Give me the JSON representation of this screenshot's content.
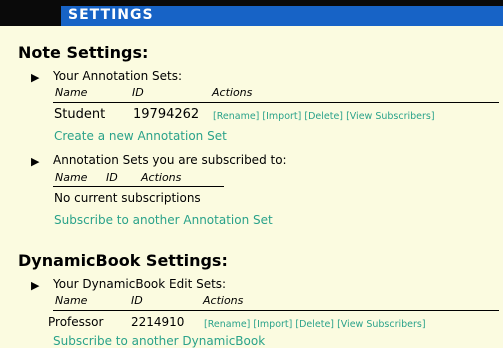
{
  "header": {
    "title": "SETTINGS"
  },
  "note_settings": {
    "title": "Note Settings:",
    "your_sets": {
      "label": "Your Annotation Sets:",
      "columns": [
        "Name",
        "ID",
        "Actions"
      ],
      "rows": [
        {
          "name": "Student",
          "id": "19794262",
          "actions": [
            "[Rename]",
            "[Import]",
            "[Delete]",
            "[View Subscribers]"
          ]
        }
      ],
      "create_link": "Create a new Annotation Set"
    },
    "subscribed": {
      "label": "Annotation Sets you are subscribed to:",
      "columns": [
        "Name",
        "ID",
        "Actions"
      ],
      "empty_text": "No current subscriptions",
      "subscribe_link": "Subscribe to another Annotation Set"
    }
  },
  "dynamicbook_settings": {
    "title": "DynamicBook Settings:",
    "your_sets": {
      "label": "Your DynamicBook Edit Sets:",
      "columns": [
        "Name",
        "ID",
        "Actions"
      ],
      "rows": [
        {
          "name": "Professor",
          "id": "2214910",
          "actions": [
            "[Rename]",
            "[Import]",
            "[Delete]",
            "[View Subscribers]"
          ]
        }
      ],
      "subscribe_link": "Subscribe to another DynamicBook"
    }
  },
  "colors": {
    "link": "#2aa28a",
    "header_bar": "#0a0a0a",
    "header_accent": "#1763c6",
    "background": "#fbfbe0"
  }
}
